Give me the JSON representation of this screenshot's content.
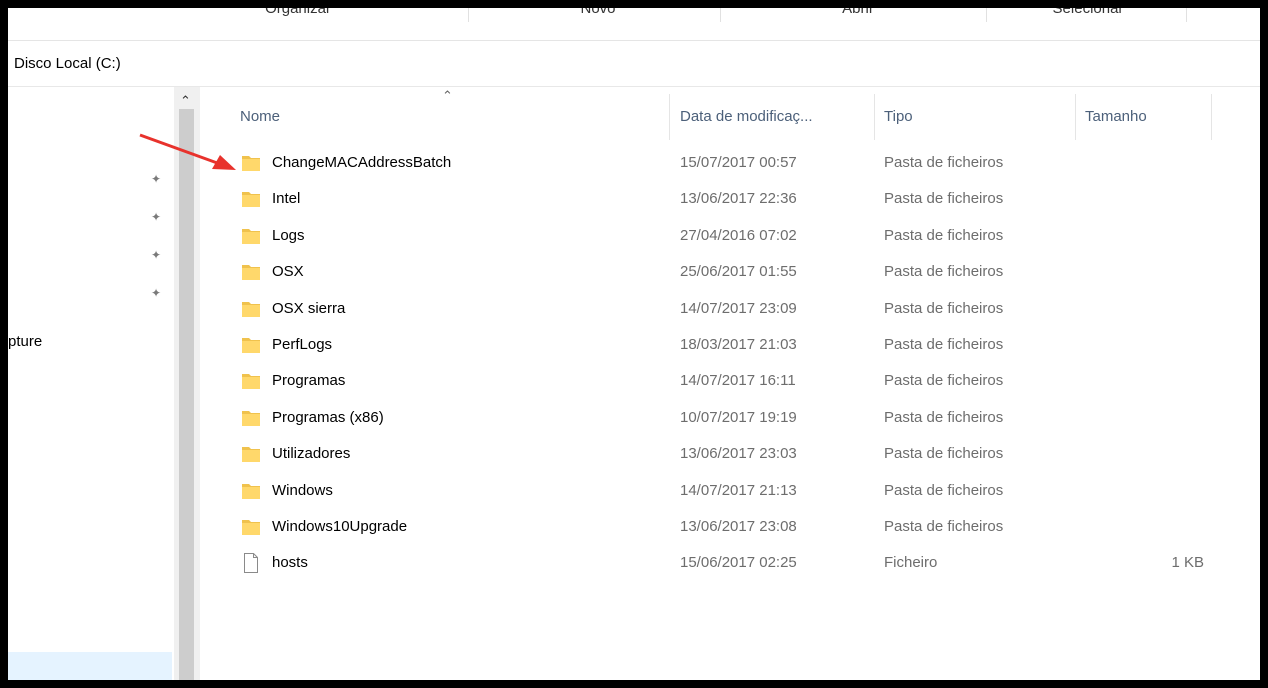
{
  "ribbon": {
    "groups": [
      "Organizar",
      "Novo",
      "Abrir",
      "Selecionar"
    ]
  },
  "address": {
    "path": "Disco Local (C:)"
  },
  "nav": {
    "partial_item": "pture"
  },
  "columns": {
    "name": "Nome",
    "date": "Data de modificaç...",
    "type": "Tipo",
    "size": "Tamanho"
  },
  "files": [
    {
      "name": "ChangeMACAddressBatch",
      "date": "15/07/2017 00:57",
      "type": "Pasta de ficheiros",
      "size": "",
      "icon": "folder-icon"
    },
    {
      "name": "Intel",
      "date": "13/06/2017 22:36",
      "type": "Pasta de ficheiros",
      "size": "",
      "icon": "folder-icon"
    },
    {
      "name": "Logs",
      "date": "27/04/2016 07:02",
      "type": "Pasta de ficheiros",
      "size": "",
      "icon": "folder-icon"
    },
    {
      "name": "OSX",
      "date": "25/06/2017 01:55",
      "type": "Pasta de ficheiros",
      "size": "",
      "icon": "folder-icon"
    },
    {
      "name": "OSX sierra",
      "date": "14/07/2017 23:09",
      "type": "Pasta de ficheiros",
      "size": "",
      "icon": "folder-icon"
    },
    {
      "name": "PerfLogs",
      "date": "18/03/2017 21:03",
      "type": "Pasta de ficheiros",
      "size": "",
      "icon": "folder-icon"
    },
    {
      "name": "Programas",
      "date": "14/07/2017 16:11",
      "type": "Pasta de ficheiros",
      "size": "",
      "icon": "folder-icon"
    },
    {
      "name": "Programas (x86)",
      "date": "10/07/2017 19:19",
      "type": "Pasta de ficheiros",
      "size": "",
      "icon": "folder-icon"
    },
    {
      "name": "Utilizadores",
      "date": "13/06/2017 23:03",
      "type": "Pasta de ficheiros",
      "size": "",
      "icon": "folder-icon"
    },
    {
      "name": "Windows",
      "date": "14/07/2017 21:13",
      "type": "Pasta de ficheiros",
      "size": "",
      "icon": "folder-icon"
    },
    {
      "name": "Windows10Upgrade",
      "date": "13/06/2017 23:08",
      "type": "Pasta de ficheiros",
      "size": "",
      "icon": "folder-icon"
    },
    {
      "name": "hosts",
      "date": "15/06/2017 02:25",
      "type": "Ficheiro",
      "size": "1 KB",
      "icon": "file-icon"
    }
  ],
  "colors": {
    "folder": "#ffd86b",
    "arrow": "#e8322c",
    "header_text": "#4c607a"
  }
}
